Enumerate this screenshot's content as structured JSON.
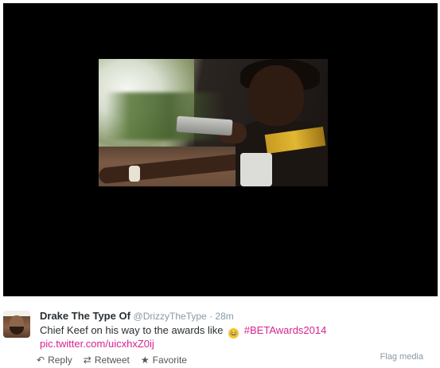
{
  "tweet": {
    "display_name": "Drake The Type Of",
    "handle": "@DrizzyTheType",
    "separator": " · ",
    "time": "28m",
    "text": "Chief Keef on his way to the awards like",
    "emoji": "😂",
    "hashtag": "#BETAwards2014",
    "link": "pic.twitter.com/uicxhxZ0ij"
  },
  "actions": {
    "reply": {
      "icon": "reply-icon",
      "label": "Reply"
    },
    "retweet": {
      "icon": "retweet-icon",
      "label": "Retweet"
    },
    "favorite": {
      "icon": "star-icon",
      "label": "Favorite"
    }
  },
  "flag_label": "Flag media",
  "colors": {
    "media_background": "#000000",
    "hashtag": "#d6238f",
    "link": "#d6238f",
    "muted": "#8899a6"
  }
}
